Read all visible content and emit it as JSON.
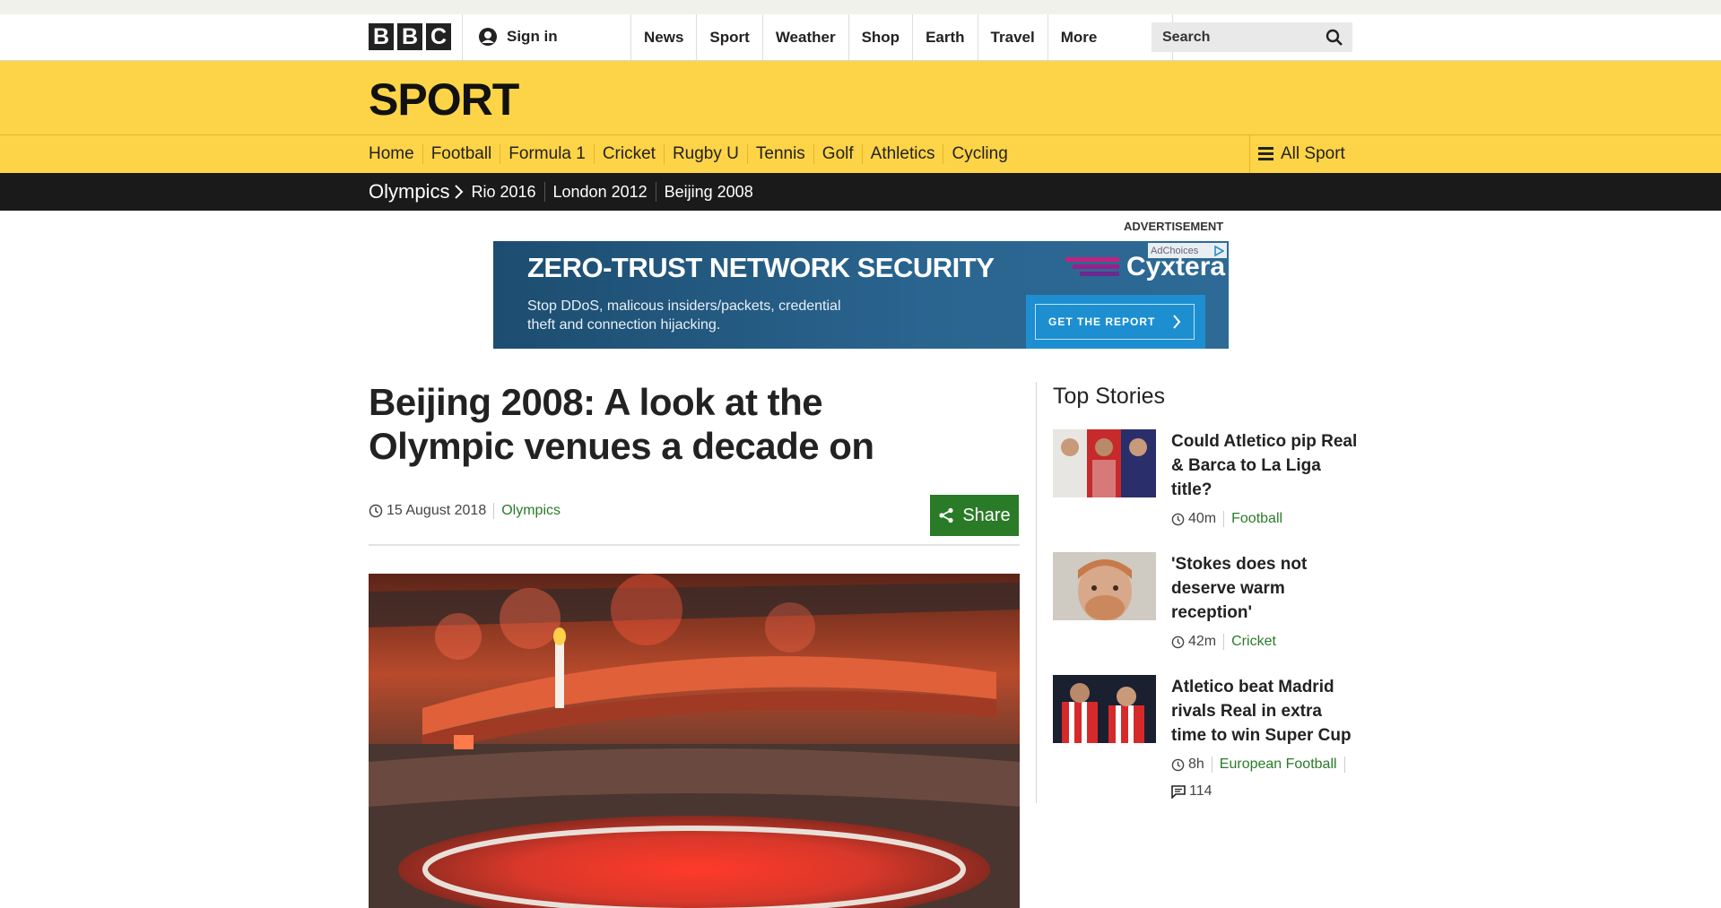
{
  "global_nav": {
    "logo_letters": [
      "B",
      "B",
      "C"
    ],
    "signin": "Sign in",
    "items": [
      "News",
      "Sport",
      "Weather",
      "Shop",
      "Earth",
      "Travel"
    ],
    "more": "More",
    "search_placeholder": "Search"
  },
  "sport": {
    "title": "SPORT",
    "nav": [
      "Home",
      "Football",
      "Formula 1",
      "Cricket",
      "Rugby U",
      "Tennis",
      "Golf",
      "Athletics",
      "Cycling"
    ],
    "all_sport": "All Sport"
  },
  "subnav": {
    "section": "Olympics",
    "items": [
      "Rio 2016",
      "London 2012",
      "Beijing 2008"
    ]
  },
  "ad": {
    "label": "ADVERTISEMENT",
    "headline": "ZERO-TRUST NETWORK SECURITY",
    "body": "Stop DDoS, malicous insiders/packets, credential theft and connection hijacking.",
    "brand": "Cyxtera",
    "adchoices": "AdChoices",
    "cta": "GET THE REPORT"
  },
  "article": {
    "headline": "Beijing 2008: A look at the Olympic venues a decade on",
    "date": "15 August 2018",
    "section": "Olympics",
    "share": "Share"
  },
  "top_stories": {
    "title": "Top Stories",
    "stories": [
      {
        "headline": "Could Atletico pip Real & Barca to La Liga title?",
        "time": "40m",
        "section": "Football",
        "comments": ""
      },
      {
        "headline": "'Stokes does not deserve warm reception'",
        "time": "42m",
        "section": "Cricket",
        "comments": ""
      },
      {
        "headline": "Atletico beat Madrid rivals Real in extra time to win Super Cup",
        "time": "8h",
        "section": "European Football",
        "comments": "114"
      }
    ]
  },
  "colors": {
    "sport_yellow": "#fdd447",
    "link_green": "#2a7b28",
    "nav_black": "#1a1a1a"
  }
}
